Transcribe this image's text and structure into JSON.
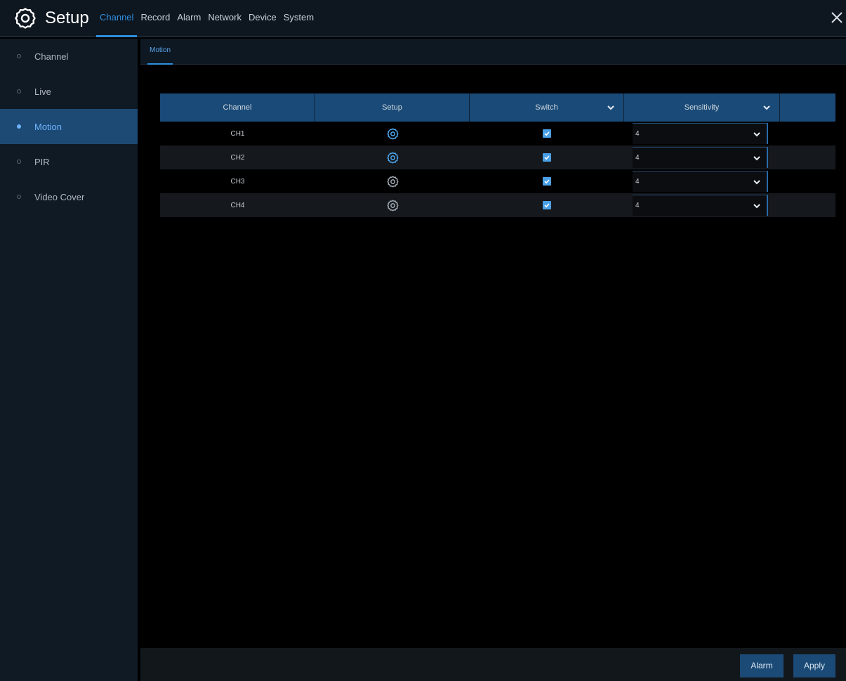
{
  "header": {
    "title": "Setup",
    "menu": [
      {
        "label": "Channel",
        "active": true
      },
      {
        "label": "Record",
        "active": false
      },
      {
        "label": "Alarm",
        "active": false
      },
      {
        "label": "Network",
        "active": false
      },
      {
        "label": "Device",
        "active": false
      },
      {
        "label": "System",
        "active": false
      }
    ]
  },
  "sidebar": {
    "items": [
      {
        "label": "Channel",
        "active": false
      },
      {
        "label": "Live",
        "active": false
      },
      {
        "label": "Motion",
        "active": true
      },
      {
        "label": "PIR",
        "active": false
      },
      {
        "label": "Video Cover",
        "active": false
      }
    ]
  },
  "subtabs": [
    {
      "label": "Motion",
      "active": true
    }
  ],
  "table": {
    "headers": [
      "Channel",
      "Setup",
      "Switch",
      "Sensitivity",
      ""
    ],
    "rows": [
      {
        "channel": "CH1",
        "setup_icon": "gear-icon",
        "setup_highlight": true,
        "switch": true,
        "sensitivity": "4"
      },
      {
        "channel": "CH2",
        "setup_icon": "gear-icon",
        "setup_highlight": true,
        "switch": true,
        "sensitivity": "4"
      },
      {
        "channel": "CH3",
        "setup_icon": "gear-icon",
        "setup_highlight": false,
        "switch": true,
        "sensitivity": "4"
      },
      {
        "channel": "CH4",
        "setup_icon": "gear-icon",
        "setup_highlight": false,
        "switch": true,
        "sensitivity": "4"
      }
    ]
  },
  "footer": {
    "alarm_label": "Alarm",
    "apply_label": "Apply"
  },
  "colors": {
    "accent": "#2f8fe0",
    "header_row": "#1a4a77",
    "active_sidebar": "#1c4a74",
    "gear_active": "#4aa0e6",
    "gear_inactive": "#9aa3ad"
  }
}
